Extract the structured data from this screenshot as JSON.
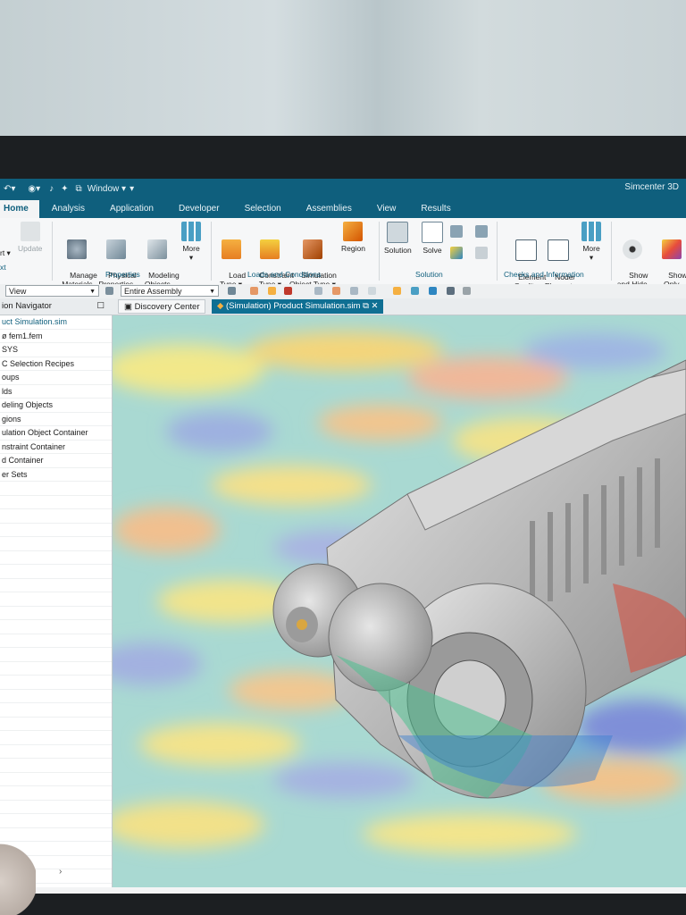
{
  "quick_access": {
    "window_label": "Window ▾",
    "app_name": "Simcenter 3D"
  },
  "tabs": [
    "Home",
    "Analysis",
    "Application",
    "Developer",
    "Selection",
    "Assemblies",
    "View",
    "Results"
  ],
  "ribbon": {
    "partial_left": [
      "Update",
      "rt ▾",
      "xt"
    ],
    "buttons": {
      "manage_materials": "Manage\nMaterials",
      "physical_properties": "Physical\nProperties",
      "modeling_objects": "Modeling\nObjects",
      "more1": "More",
      "load_type": "Load\nType ▾",
      "constraint_type": "Constraint\nType ▾",
      "simulation_object_type": "Simulation\nObject Type ▾",
      "region": "Region",
      "solution": "Solution",
      "solve": "Solve",
      "element_quality": "Element\nQuality",
      "node_element": "Node/\nElement",
      "more2": "More",
      "show_and_hide": "Show\nand Hide",
      "show_only": "Show\nOnly"
    },
    "groups": {
      "properties": "Properties",
      "loads_and_conditions": "Loads and Conditions",
      "solution": "Solution",
      "checks": "Checks and Information"
    }
  },
  "command_bar": {
    "filter_value": "View",
    "assembly_value": "Entire Assembly"
  },
  "doc_tabs": {
    "navigator_header": "ion Navigator",
    "discovery_center": "Discovery Center",
    "active_file": "(Simulation) Product Simulation.sim"
  },
  "navigator": {
    "items": [
      "uct Simulation.sim",
      "ø fem1.fem",
      "SYS",
      "C Selection Recipes",
      "oups",
      "lds",
      "deling Objects",
      "gions",
      "ulation Object Container",
      "nstraint Container",
      "d Container",
      "er Sets"
    ],
    "scroll_arrow": "›"
  },
  "colors": {
    "accent": "#0f5f7d",
    "ribbon_bg": "#f6f7f8",
    "active_tab_text": "#ffffff"
  }
}
